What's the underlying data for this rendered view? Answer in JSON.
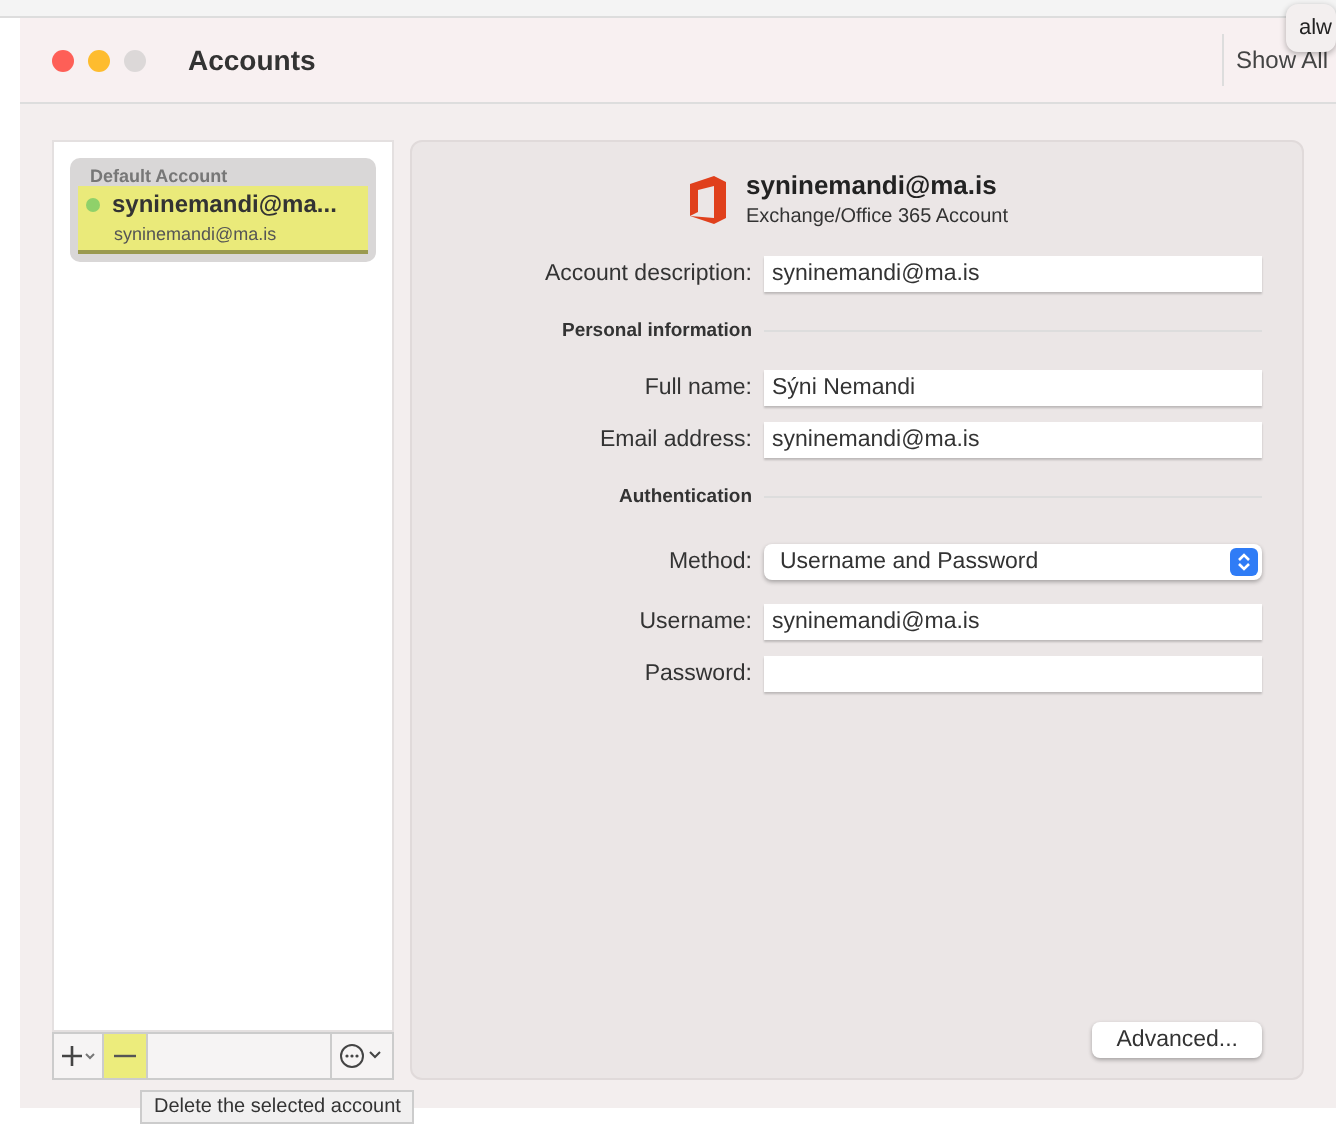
{
  "background_window": {
    "popup_text": "alw"
  },
  "window": {
    "title": "Accounts",
    "show_all": "Show All"
  },
  "sidebar": {
    "accounts": [
      {
        "group": "Default Account",
        "name": "syninemandi@ma...",
        "email": "syninemandi@ma.is",
        "selected": true,
        "online": true,
        "highlighted": true
      }
    ],
    "toolbar": [
      {
        "kind": "add"
      },
      {
        "kind": "remove",
        "highlighted": true
      },
      {
        "kind": "spacer"
      },
      {
        "kind": "more"
      }
    ]
  },
  "tooltip": "Delete the selected account",
  "detail": {
    "account_name": "syninemandi@ma.is",
    "account_type": "Exchange/Office 365 Account",
    "rows": [
      {
        "kind": "field",
        "label": "Account description:",
        "value": "syninemandi@ma.is"
      },
      {
        "kind": "section",
        "label": "Personal information"
      },
      {
        "kind": "field",
        "label": "Full name:",
        "value": "Sýni Nemandi"
      },
      {
        "kind": "field",
        "label": "Email address:",
        "value": "syninemandi@ma.is"
      },
      {
        "kind": "section",
        "label": "Authentication"
      },
      {
        "kind": "select",
        "label": "Method:",
        "value": "Username and Password"
      },
      {
        "kind": "field",
        "label": "Username:",
        "value": "syninemandi@ma.is"
      },
      {
        "kind": "field",
        "label": "Password:",
        "value": ""
      }
    ],
    "advanced_button": "Advanced..."
  }
}
